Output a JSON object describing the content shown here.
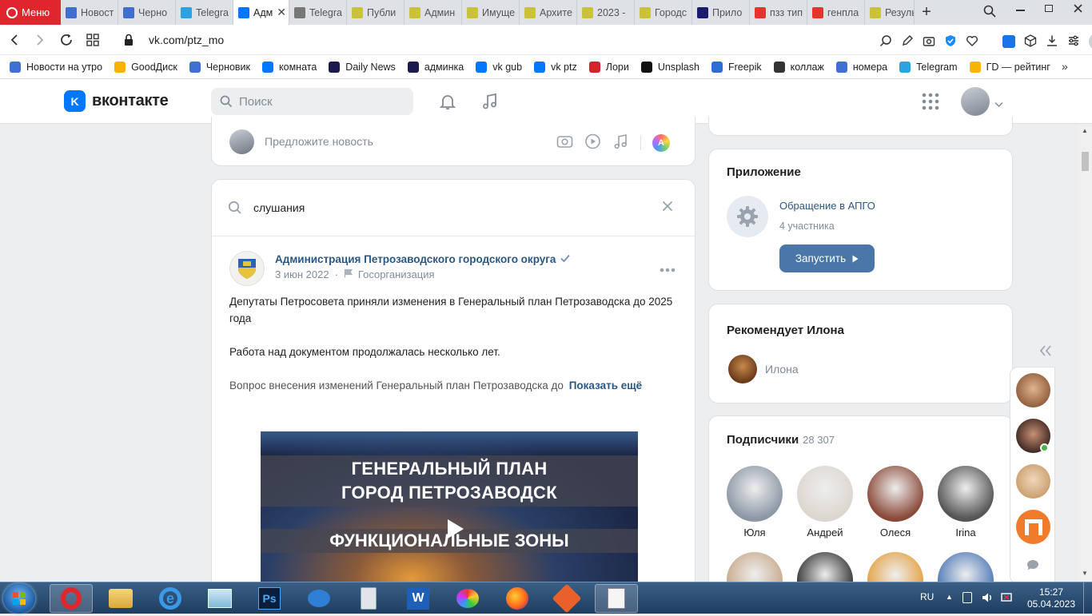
{
  "browser": {
    "menu_label": "Меню",
    "tabs": [
      {
        "label": "Новост",
        "color": "#3f6fd1"
      },
      {
        "label": "Черно",
        "color": "#3f6fd1"
      },
      {
        "label": "Telegra",
        "color": "#2aa3e0"
      },
      {
        "label": "Адм",
        "color": "#0077ff",
        "active": true
      },
      {
        "label": "Telegra",
        "color": "#777"
      },
      {
        "label": "Публи",
        "color": "#c9c23a"
      },
      {
        "label": "Админ",
        "color": "#c9c23a"
      },
      {
        "label": "Имуще",
        "color": "#c9c23a"
      },
      {
        "label": "Архите",
        "color": "#c9c23a"
      },
      {
        "label": "2023 -",
        "color": "#c9c23a"
      },
      {
        "label": "Городс",
        "color": "#c9c23a"
      },
      {
        "label": "Прило",
        "color": "#1a1a6e"
      },
      {
        "label": "пзз тип",
        "color": "#e8322c"
      },
      {
        "label": "генпла",
        "color": "#e8322c"
      },
      {
        "label": "Резуль",
        "color": "#c9c23a"
      }
    ],
    "url": "vk.com/ptz_mo",
    "bookmarks": [
      {
        "label": "Новости на утро",
        "color": "#3f6fd1"
      },
      {
        "label": "GoodДиск",
        "color": "#f4b400"
      },
      {
        "label": "Черновик",
        "color": "#3f6fd1"
      },
      {
        "label": "комната",
        "color": "#0077ff"
      },
      {
        "label": "Daily News",
        "color": "#1a1a4e"
      },
      {
        "label": "админка",
        "color": "#1a1a4e"
      },
      {
        "label": "vk gub",
        "color": "#0077ff"
      },
      {
        "label": "vk ptz",
        "color": "#0077ff"
      },
      {
        "label": "Лори",
        "color": "#d6222a"
      },
      {
        "label": "Unsplash",
        "color": "#111"
      },
      {
        "label": "Freepik",
        "color": "#2a6fd6"
      },
      {
        "label": "коллаж",
        "color": "#333"
      },
      {
        "label": "номера",
        "color": "#3f6fd1"
      },
      {
        "label": "Telegram",
        "color": "#2aa3e0"
      },
      {
        "label": "ГD — рейтинг",
        "color": "#f4b400"
      }
    ]
  },
  "vk": {
    "logo_text": "вконтакте",
    "search_placeholder": "Поиск"
  },
  "composer": {
    "placeholder": "Предложите новость"
  },
  "search": {
    "query": "слушания"
  },
  "post": {
    "author": "Администрация Петрозаводского городского округа",
    "date": "3 июн 2022",
    "category": "Госорганизация",
    "para1": "Депутаты Петросовета приняли изменения в Генеральный план Петрозаводска до 2025 года",
    "para2": "Работа над документом продолжалась несколько лет.",
    "para3": "Вопрос внесения изменений Генеральный план Петрозаводска до",
    "show_more": "Показать ещё",
    "image_line1": "ГЕНЕРАЛЬНЫЙ ПЛАН",
    "image_line2": "ГОРОД ПЕТРОЗАВОДСК",
    "image_line3": "ФУНКЦИОНАЛЬНЫЕ ЗОНЫ"
  },
  "app_block": {
    "title": "Приложение",
    "app_name": "Обращение в АПГО",
    "members": "4 участника",
    "launch": "Запустить"
  },
  "recommend": {
    "title": "Рекомендует Илона",
    "name": "Илона"
  },
  "subscribers": {
    "title": "Подписчики",
    "count": "28 307",
    "people": [
      {
        "name": "Юля",
        "color": "#8c97a6"
      },
      {
        "name": "Андрей",
        "color": "#dcd6cf"
      },
      {
        "name": "Олеся",
        "color": "#8a4a3a"
      },
      {
        "name": "Irina",
        "color": "#555"
      }
    ],
    "row2_colors": [
      "#c7a98a",
      "#333",
      "#e3a040",
      "#4d78b6"
    ]
  },
  "taskbar": {
    "lang": "RU",
    "time": "15:27",
    "date": "05.04.2023"
  }
}
